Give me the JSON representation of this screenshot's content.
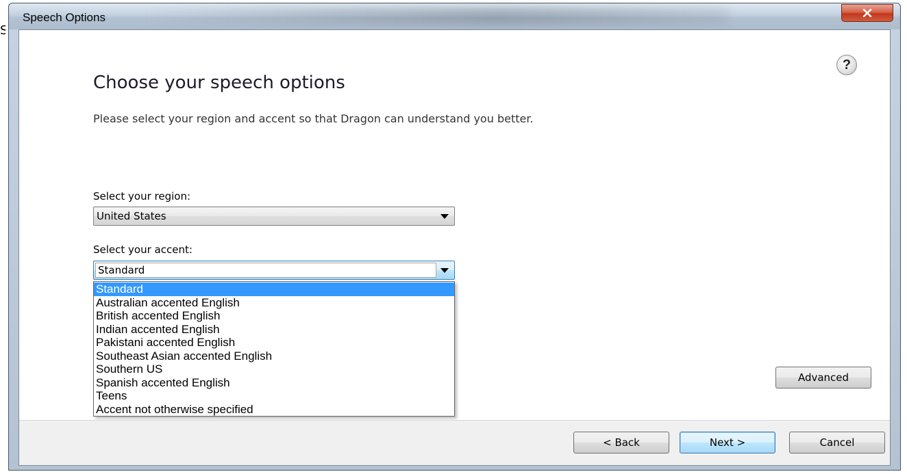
{
  "stray_text": "S",
  "window": {
    "title": "Speech Options",
    "close_glyph": "x"
  },
  "dialog": {
    "help_glyph": "?",
    "heading": "Choose your speech options",
    "subtitle": "Please select your region and accent so that Dragon can understand you better."
  },
  "region": {
    "label": "Select your region:",
    "value": "United States"
  },
  "accent": {
    "label": "Select your accent:",
    "value": "Standard",
    "options": [
      "Standard",
      "Australian accented English",
      "British accented English",
      "Indian accented English",
      "Pakistani accented English",
      "Southeast Asian accented English",
      "Southern US",
      "Spanish accented English",
      "Teens",
      "Accent not otherwise specified"
    ],
    "selected_index": 0
  },
  "buttons": {
    "advanced": "Advanced",
    "back": "< Back",
    "next": "Next >",
    "cancel": "Cancel"
  },
  "colors": {
    "selection": "#3399ff",
    "close_button": "#c1381c",
    "default_button_border": "#3c7fb1"
  }
}
